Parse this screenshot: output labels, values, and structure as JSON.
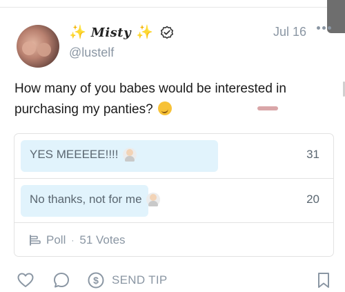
{
  "post": {
    "author": {
      "display_name": "Misty",
      "sparkle_left": "✨",
      "sparkle_right": "✨",
      "handle": "@lustelf"
    },
    "date": "Jul 16",
    "text": "How many of you babes would be interested in purchasing my panties?",
    "icons": {
      "avatar": "avatar-photo",
      "verified": "verified-check-icon",
      "more": "more-options-icon",
      "emoji": "smirking-face-emoji"
    }
  },
  "poll": {
    "options": [
      {
        "label": "YES MEEEEE!!!!",
        "votes": "31",
        "share": 0.62,
        "emoji": "person-raising-hand-emoji"
      },
      {
        "label": "No thanks, not for me",
        "votes": "20",
        "share": 0.4,
        "emoji": "person-gesturing-no-emoji"
      }
    ],
    "type_label": "Poll",
    "votes_label": "51 Votes",
    "separator": "·"
  },
  "actions": {
    "like_icon": "heart-icon",
    "comment_icon": "comment-icon",
    "tip_icon": "dollar-circle-icon",
    "send_tip_label": "SEND TIP",
    "bookmark_icon": "bookmark-icon"
  },
  "colors": {
    "poll_bar": "#e1f3fc",
    "muted_text": "#8a96a3",
    "sparkle": "#f4c21b"
  }
}
